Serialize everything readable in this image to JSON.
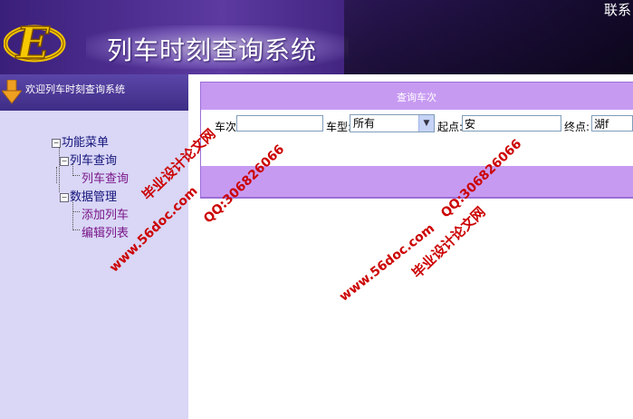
{
  "header": {
    "title": "列车时刻查询系统",
    "top_link": "联系",
    "logo_letter": "E"
  },
  "sidebar": {
    "welcome": "欢迎列车时刻查询系统",
    "tree": {
      "root": "功能菜单",
      "groups": [
        {
          "label": "列车查询",
          "items": [
            "列车查询"
          ]
        },
        {
          "label": "数据管理",
          "items": [
            "添加列车",
            "编辑列表"
          ]
        }
      ]
    }
  },
  "main": {
    "panel_title": "查询车次",
    "fields": {
      "train_no_label": "车次:",
      "train_no_value": "",
      "type_label": "车型:",
      "type_selected": "所有",
      "from_label": "起点:",
      "from_value": "安",
      "to_label": "终点:",
      "to_value": "湖f"
    }
  },
  "watermarks": {
    "site": "www.56doc.com",
    "qq": "QQ:306826066",
    "name": "毕业设计论文网"
  },
  "colors": {
    "banner": "#3b1f78",
    "sidebar_bg": "#d9d6f6",
    "panel_header": "#c79af2",
    "watermark": "#cc0000"
  }
}
